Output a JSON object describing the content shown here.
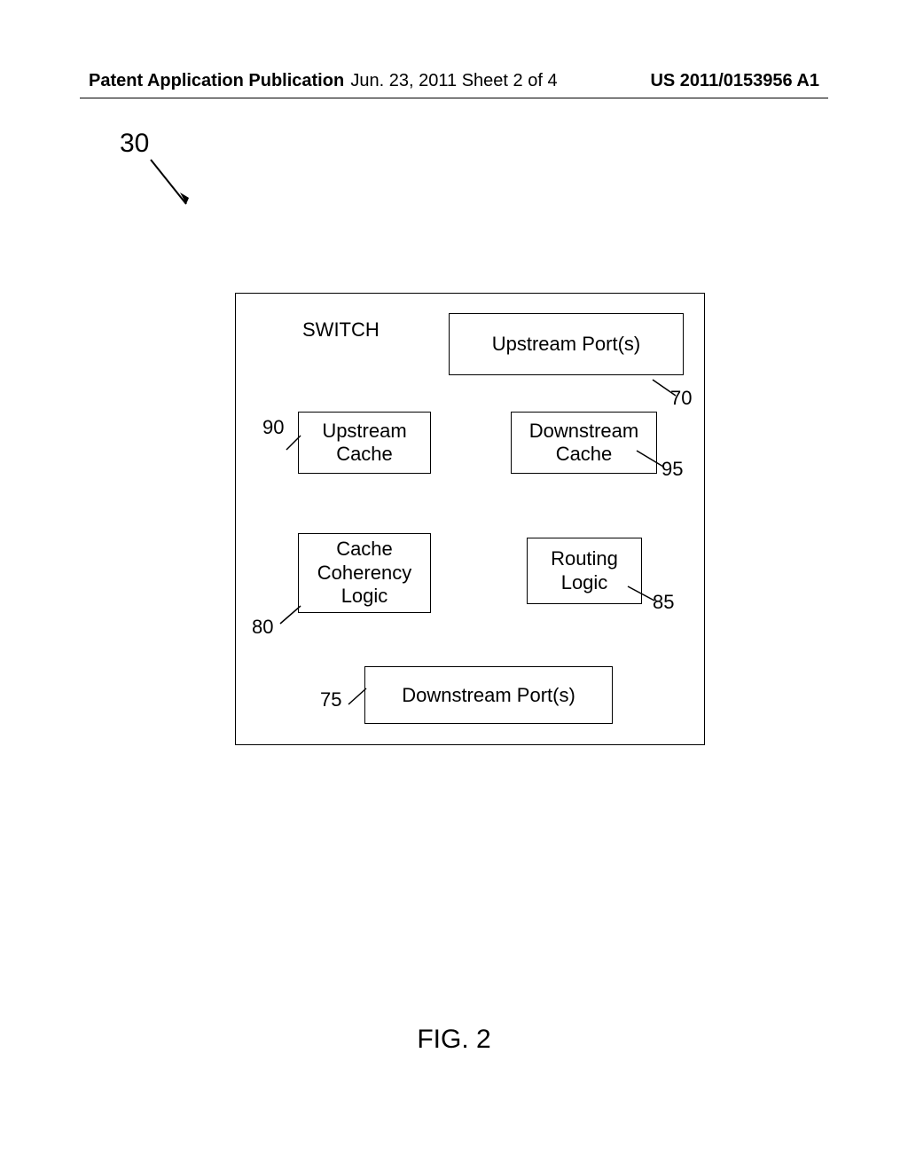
{
  "header": {
    "left": "Patent Application Publication",
    "center": "Jun. 23, 2011  Sheet 2 of 4",
    "right": "US 2011/0153956 A1"
  },
  "diagram": {
    "ref_main": "30",
    "switch_label": "SWITCH",
    "components": {
      "upstream_ports": {
        "label": "Upstream Port(s)",
        "ref": "70"
      },
      "upstream_cache": {
        "label": "Upstream\nCache",
        "ref": "90"
      },
      "downstream_cache": {
        "label": "Downstream\nCache",
        "ref": "95"
      },
      "cache_coherency": {
        "label": "Cache\nCoherency\nLogic",
        "ref": "80"
      },
      "routing_logic": {
        "label": "Routing\nLogic",
        "ref": "85"
      },
      "downstream_ports": {
        "label": "Downstream Port(s)",
        "ref": "75"
      }
    }
  },
  "figure_label": "FIG. 2"
}
